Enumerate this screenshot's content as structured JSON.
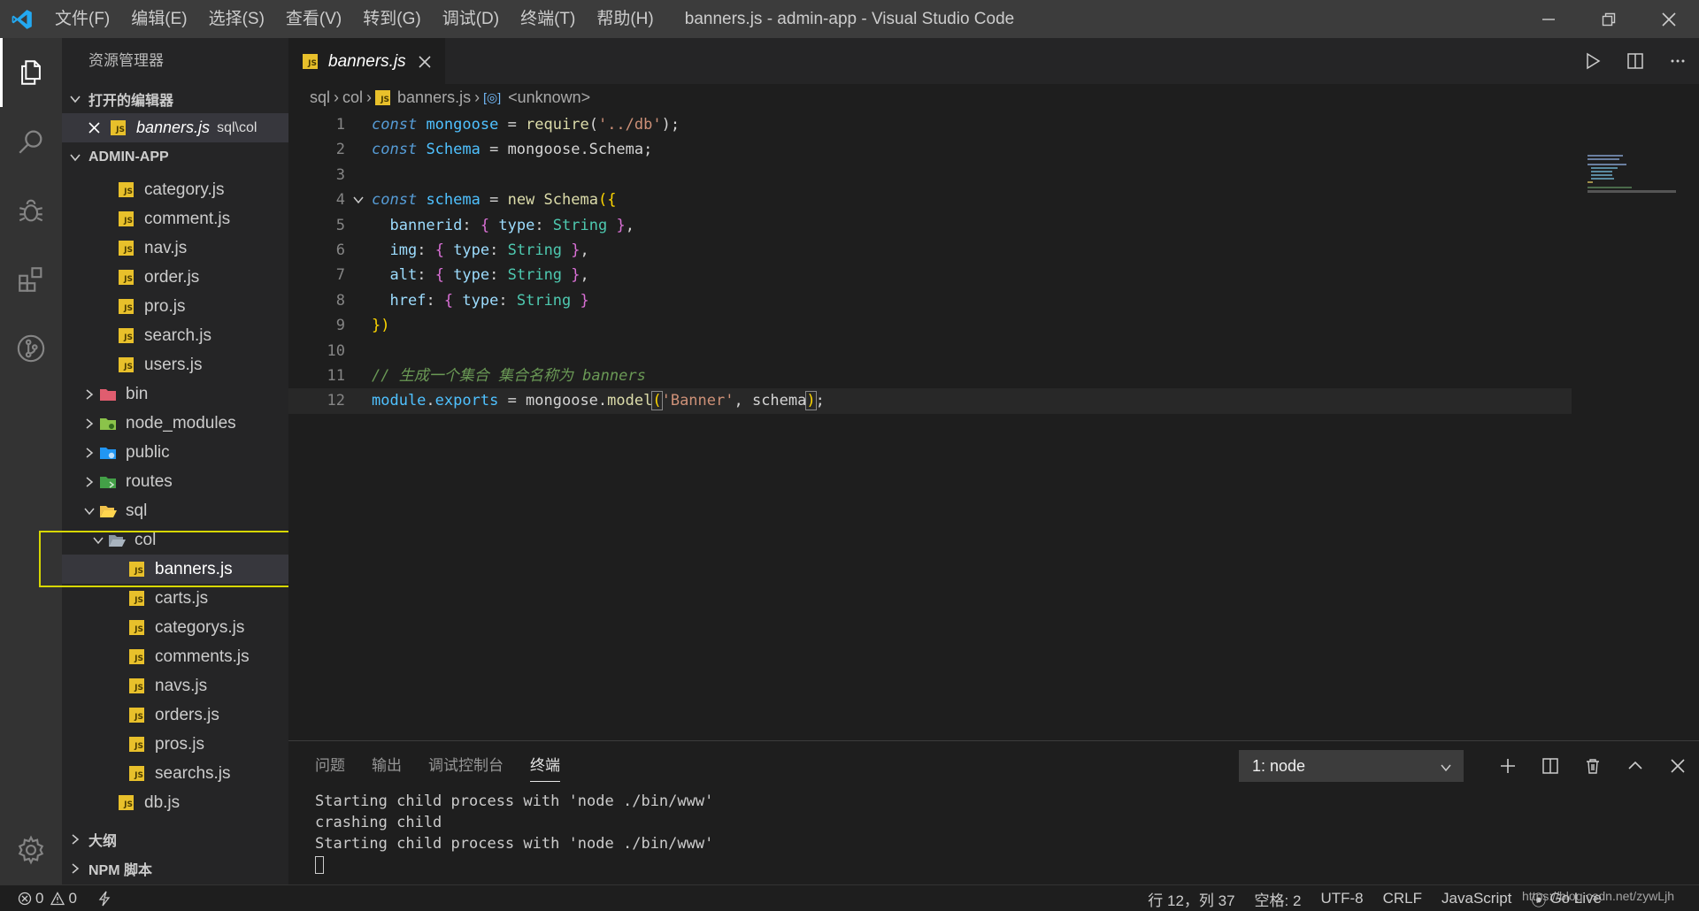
{
  "titlebar": {
    "menu": [
      "文件(F)",
      "编辑(E)",
      "选择(S)",
      "查看(V)",
      "转到(G)",
      "调试(D)",
      "终端(T)",
      "帮助(H)"
    ],
    "title": "banners.js - admin-app - Visual Studio Code"
  },
  "activity": [
    "explorer-icon",
    "search-icon",
    "debug-icon",
    "extensions-icon",
    "git-icon",
    "settings-gear-icon"
  ],
  "sidebar": {
    "title": "资源管理器",
    "open_editors_label": "打开的编辑器",
    "open_editor": {
      "name": "banners.js",
      "path": "sql\\col"
    },
    "project_label": "ADMIN-APP",
    "files_top": [
      "category.js",
      "comment.js",
      "nav.js",
      "order.js",
      "pro.js",
      "search.js",
      "users.js"
    ],
    "folders": [
      "bin",
      "node_modules",
      "public",
      "routes"
    ],
    "sql_folder": "sql",
    "col_folder": "col",
    "col_files": [
      "banners.js",
      "carts.js",
      "categorys.js",
      "comments.js",
      "navs.js",
      "orders.js",
      "pros.js",
      "searchs.js"
    ],
    "db_file": "db.js",
    "outline_label": "大纲",
    "npm_label": "NPM 脚本"
  },
  "editor": {
    "tab_label": "banners.js",
    "breadcrumbs": [
      "sql",
      "col",
      "banners.js",
      "<unknown>"
    ],
    "line_numbers": [
      "1",
      "2",
      "3",
      "4",
      "5",
      "6",
      "7",
      "8",
      "9",
      "10",
      "11",
      "12"
    ],
    "code": {
      "l1_kw": "const",
      "l1_var": "mongoose",
      "l1_eq": " = ",
      "l1_fn": "require",
      "l1_p1": "(",
      "l1_str": "'../db'",
      "l1_p2": ");",
      "l2_kw": "const",
      "l2_var": "Schema",
      "l2_rest": " = mongoose.Schema;",
      "l4_kw": "const",
      "l4_var": "schema",
      "l4_eq": " = ",
      "l4_new": "new",
      "l4_cls": "Schema",
      "l4_open": "({",
      "l5_prop": "bannerid",
      "l6_prop": "img",
      "l7_prop": "alt",
      "l8_prop": "href",
      "type_key": "type",
      "type_val": "String",
      "l9_close": "})",
      "l11_comment": "// 生成一个集合 集合名称为 banners",
      "l12_mod": "module",
      "l12_exp": "exports",
      "l12_mid": " = mongoose.",
      "l12_fn": "model",
      "l12_str": "'Banner'",
      "l12_arg": ", schema",
      "l12_end": ";"
    }
  },
  "panel": {
    "tabs": [
      "问题",
      "输出",
      "调试控制台",
      "终端"
    ],
    "active_tab": "终端",
    "terminal_select": "1: node",
    "terminal_lines": [
      "Starting child process with 'node ./bin/www'",
      "crashing child",
      "Starting child process with 'node ./bin/www'"
    ]
  },
  "statusbar": {
    "errors": "0",
    "warnings": "0",
    "position": "行 12，列 37",
    "spaces": "空格: 2",
    "encoding": "UTF-8",
    "eol": "CRLF",
    "language": "JavaScript",
    "golive": "Go Live",
    "watermark": "https://blog.csdn.net/zywLjh"
  },
  "colors": {
    "accent": "#007acc",
    "titlebar": "#3c3c3c",
    "sidebar": "#252526",
    "editor": "#1e1e1e",
    "js_badge": "#e8c02b",
    "highlight_box": "#d7d700"
  }
}
